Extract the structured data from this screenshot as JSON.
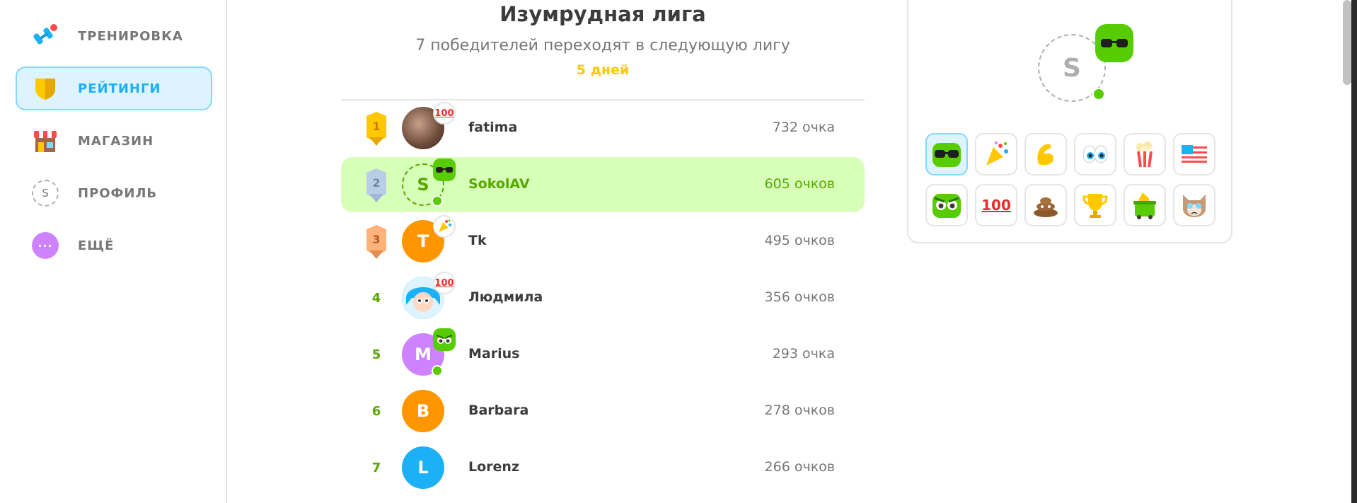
{
  "sidebar": {
    "items": [
      {
        "label": "ТРЕНИРОВКА",
        "icon": "dumbbell-icon",
        "active": false
      },
      {
        "label": "РЕЙТИНГИ",
        "icon": "shield-icon",
        "active": true
      },
      {
        "label": "МАГАЗИН",
        "icon": "shop-icon",
        "active": false
      },
      {
        "label": "ПРОФИЛЬ",
        "icon": "profile-icon",
        "icon_letter": "S",
        "active": false
      },
      {
        "label": "ЕЩЁ",
        "icon": "more-icon",
        "active": false
      }
    ]
  },
  "league": {
    "title": "Изумрудная лига",
    "subtitle": "7 победителей переходят в следующую лигу",
    "days_left": "5 дней"
  },
  "leaderboard": [
    {
      "rank": "1",
      "name": "fatima",
      "points": "732 очка",
      "avatar_letter": "",
      "avatar_color": "#8a6e62",
      "badge": "100",
      "medal": "gold",
      "online": false
    },
    {
      "rank": "2",
      "name": "SokolAV",
      "points": "605 очков",
      "avatar_letter": "S",
      "avatar_color": "#d7ffb8",
      "badge": "sunglasses-owl",
      "medal": "silver",
      "online": true,
      "me": true
    },
    {
      "rank": "3",
      "name": "Tk",
      "points": "495 очков",
      "avatar_letter": "T",
      "avatar_color": "#ff9600",
      "badge": "party",
      "medal": "bronze",
      "online": false
    },
    {
      "rank": "4",
      "name": "Людмила",
      "points": "356 очков",
      "avatar_letter": "",
      "avatar_color": "#1cb0f6",
      "badge": "100",
      "medal": "",
      "online": false
    },
    {
      "rank": "5",
      "name": "Marius",
      "points": "293 очка",
      "avatar_letter": "M",
      "avatar_color": "#ce82ff",
      "badge": "angry-owl",
      "medal": "",
      "online": true
    },
    {
      "rank": "6",
      "name": "Barbara",
      "points": "278 очков",
      "avatar_letter": "B",
      "avatar_color": "#ff9600",
      "badge": "",
      "medal": "",
      "online": false
    },
    {
      "rank": "7",
      "name": "Lorenz",
      "points": "266 очков",
      "avatar_letter": "L",
      "avatar_color": "#1cb0f6",
      "badge": "",
      "medal": "",
      "online": false
    }
  ],
  "status_card": {
    "avatar_letter": "S",
    "stickers": [
      "sunglasses-owl-icon",
      "party-popper-icon",
      "flexed-arm-icon",
      "eyes-icon",
      "popcorn-icon",
      "us-flag-icon",
      "angry-owl-icon",
      "hundred-points-icon",
      "poop-icon",
      "trophy-icon",
      "trash-fire-icon",
      "grumpy-cat-icon"
    ],
    "hundred_label": "100",
    "selected_index": 0
  },
  "colors": {
    "accent_blue": "#1cb0f6",
    "accent_green": "#58cc02",
    "me_row_bg": "#d7ffb8",
    "days_yellow": "#ffc800"
  }
}
